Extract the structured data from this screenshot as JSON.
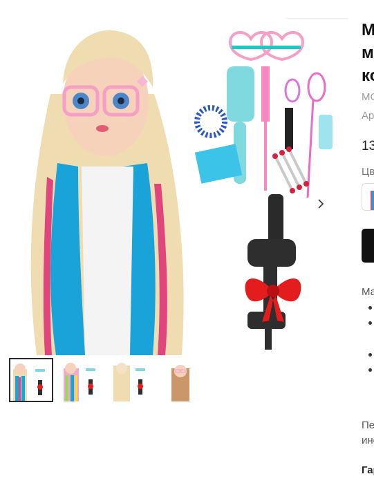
{
  "gallery": {
    "main_image_alt": "",
    "next_arrow": "chevron-right-icon",
    "thumbnails": [
      {
        "selected": true
      },
      {
        "selected": false
      },
      {
        "selected": false
      },
      {
        "selected": false
      }
    ]
  },
  "product": {
    "title_line1": "М",
    "title_line2": "м",
    "title_line3": "ко",
    "brand_fragment": "МС",
    "article_fragment": "Арт",
    "price_fragment": "13",
    "color_label_fragment": "Цв"
  },
  "description": {
    "heading_fragment": "Ма",
    "para_line1": "Пе",
    "para_line2": "инс",
    "guarantee_fragment": "Гар"
  },
  "colors": {
    "accent_dark": "#111111",
    "hair_blue": "#1aa3d9",
    "hair_pink": "#e0457b",
    "hair_blonde": "#efdcb0"
  }
}
